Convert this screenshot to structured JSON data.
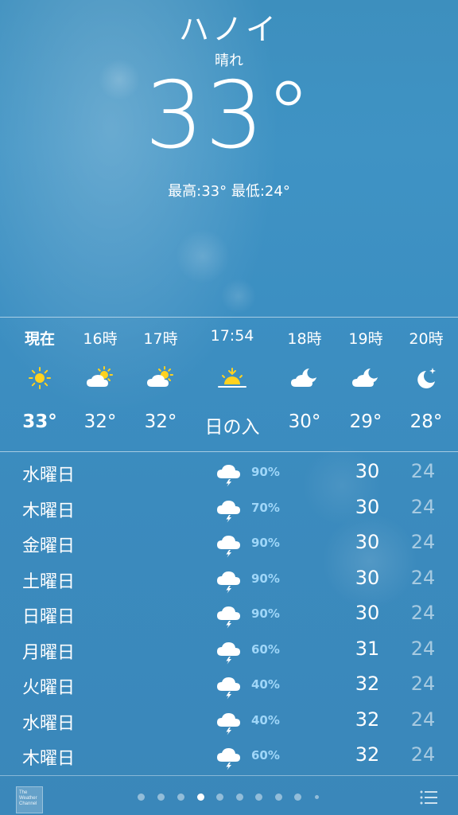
{
  "header": {
    "city": "ハノイ",
    "condition": "晴れ",
    "temperature": "33°",
    "hilo": "最高:33° 最低:24°"
  },
  "hourly": [
    {
      "label": "現在",
      "icon": "sun-icon",
      "temp": "33°"
    },
    {
      "label": "16時",
      "icon": "partly-cloudy-day-icon",
      "temp": "32°"
    },
    {
      "label": "17時",
      "icon": "partly-cloudy-day-icon",
      "temp": "32°"
    },
    {
      "label": "17:54",
      "icon": "sunset-icon",
      "temp": "日の入"
    },
    {
      "label": "18時",
      "icon": "partly-cloudy-night-icon",
      "temp": "30°"
    },
    {
      "label": "19時",
      "icon": "partly-cloudy-night-icon",
      "temp": "29°"
    },
    {
      "label": "20時",
      "icon": "moon-icon",
      "temp": "28°"
    }
  ],
  "daily": [
    {
      "day": "水曜日",
      "icon": "thunderstorm-icon",
      "pop": "90%",
      "high": "30",
      "low": "24"
    },
    {
      "day": "木曜日",
      "icon": "thunderstorm-icon",
      "pop": "70%",
      "high": "30",
      "low": "24"
    },
    {
      "day": "金曜日",
      "icon": "thunderstorm-icon",
      "pop": "90%",
      "high": "30",
      "low": "24"
    },
    {
      "day": "土曜日",
      "icon": "thunderstorm-icon",
      "pop": "90%",
      "high": "30",
      "low": "24"
    },
    {
      "day": "日曜日",
      "icon": "thunderstorm-icon",
      "pop": "90%",
      "high": "30",
      "low": "24"
    },
    {
      "day": "月曜日",
      "icon": "thunderstorm-icon",
      "pop": "60%",
      "high": "31",
      "low": "24"
    },
    {
      "day": "火曜日",
      "icon": "thunderstorm-icon",
      "pop": "40%",
      "high": "32",
      "low": "24"
    },
    {
      "day": "水曜日",
      "icon": "thunderstorm-icon",
      "pop": "40%",
      "high": "32",
      "low": "24"
    },
    {
      "day": "木曜日",
      "icon": "thunderstorm-icon",
      "pop": "60%",
      "high": "32",
      "low": "24"
    }
  ],
  "footer": {
    "logo_text": "The Weather Channel",
    "page_count": 10,
    "active_page": 4,
    "list_icon": "list-icon"
  },
  "colors": {
    "background_top": "#3d8fbe",
    "background_bottom": "#3a87ba",
    "precip_text": "#9fd6f8",
    "sun": "#ffd21f"
  }
}
